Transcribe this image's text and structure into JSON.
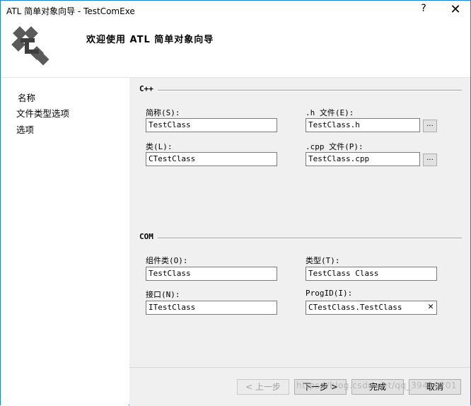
{
  "window": {
    "title": "ATL 简单对象向导 - TestComExe",
    "help_label": "?",
    "close_label": "✕"
  },
  "header": {
    "welcome": "欢迎使用 ATL 简单对象向导",
    "logo_icon": "atl-wizard-logo-icon"
  },
  "nav": {
    "items": [
      {
        "label": "名称"
      },
      {
        "label": "文件类型选项"
      },
      {
        "label": "选项"
      }
    ]
  },
  "cpp_group": {
    "title": "C++",
    "short_name": {
      "label": "简称(S):",
      "value": "TestClass"
    },
    "h_file": {
      "label": ".h 文件(E):",
      "value": "TestClass.h",
      "browse": "..."
    },
    "class": {
      "label": "类(L):",
      "value": "CTestClass"
    },
    "cpp_file": {
      "label": ".cpp 文件(P):",
      "value": "TestClass.cpp",
      "browse": "..."
    }
  },
  "com_group": {
    "title": "COM",
    "coclass": {
      "label": "组件类(O):",
      "value": "TestClass"
    },
    "type": {
      "label": "类型(T):",
      "value": "TestClass Class"
    },
    "interface": {
      "label": "接口(N):",
      "value": "ITestClass"
    },
    "progid": {
      "label": "ProgID(I):",
      "value": "CTestClass.TestClass",
      "clear": "✕"
    }
  },
  "footer": {
    "back": "< 上一步",
    "next": "下一步 >",
    "finish": "完成",
    "cancel": "取消"
  },
  "watermark": "https://blog.csdn.net/qq_39410201"
}
